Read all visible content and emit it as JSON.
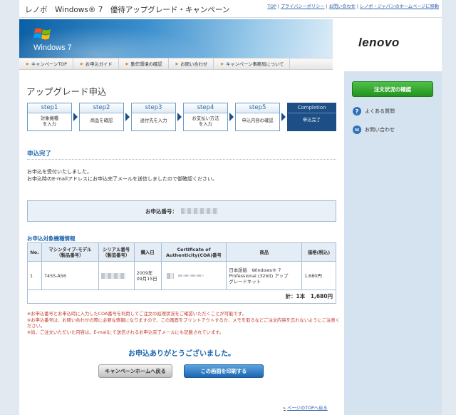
{
  "header": {
    "title": "レノボ　Windows® 7　優待アップグレード・キャンペーン",
    "links": [
      "TOP",
      "プライバシーポリシー",
      "お問い合わせ",
      "レノボ・ジャパンのホームページに移動"
    ],
    "brand": "lenovo",
    "windows_label": "Windows 7"
  },
  "nav": [
    "キャンペーンTOP",
    "お申込ガイド",
    "動作環境の確認",
    "お問い合わせ",
    "キャンペーン事務局について"
  ],
  "sidebar": {
    "status_button": "注文状況の確認",
    "faq": "よくある質問",
    "contact": "お問い合わせ"
  },
  "page_title": "アップグレード申込",
  "steps": [
    {
      "head": "step1",
      "body": [
        "対象機種",
        "を入力"
      ]
    },
    {
      "head": "step2",
      "body": [
        "商品を確認"
      ]
    },
    {
      "head": "step3",
      "body": [
        "送付先を入力"
      ]
    },
    {
      "head": "step4",
      "body": [
        "お支払い方法",
        "を入力"
      ]
    },
    {
      "head": "step5",
      "body": [
        "申込内容の確認"
      ]
    },
    {
      "head": "Completion",
      "body": [
        "申込完了"
      ]
    }
  ],
  "complete": {
    "heading": "申込完了",
    "line1": "お申込を受付いたしました。",
    "line2": "お申込時のE-mailアドレスにお申込完了メールを送信しましたので御確認ください。",
    "order_label": "お申込番号："
  },
  "table": {
    "heading": "お申込対象機種情報",
    "headers": [
      "No.",
      "マシンタイプ-モデル\n（製品番号）",
      "シリアル番号\n（製造番号）",
      "購入日",
      "Certificate of\nAuthenticity(COA)番号",
      "商品",
      "価格(税込)"
    ],
    "rows": [
      {
        "no": "1",
        "model": "7455-A56",
        "date": "2009年\n09月15日",
        "product": "日本語版　Windows® 7\nProfessional (32bit) アップ\nグレードキット",
        "price": "1,680円"
      }
    ],
    "total": "計：1本　1,680円"
  },
  "notes": [
    "※お申込番号とお申込時に入力したCOA番号を利用してご注文の処理状況をご確認いただくことが可能です。",
    "※お申込番号は、お問い合わせの際に必要な情報になりますので、この画面をプリントアウトするか、メモを取るなどご注文内容を忘れないようにご注意ください。",
    "※尚、ご注文いただいた内容は、E-mailにて送信されるお申込完了メールにも記載されています。"
  ],
  "thanks": "お申込ありがとうございました。",
  "buttons": {
    "home": "キャンペーンホームへ戻る",
    "print": "この画面を印刷する"
  },
  "to_top": "ページのTOPへ戻る",
  "colors": {
    "accent": "#1f66b0",
    "step_done": "#1d4e86",
    "green_button": "#22931f",
    "note_red": "#c0392b"
  }
}
